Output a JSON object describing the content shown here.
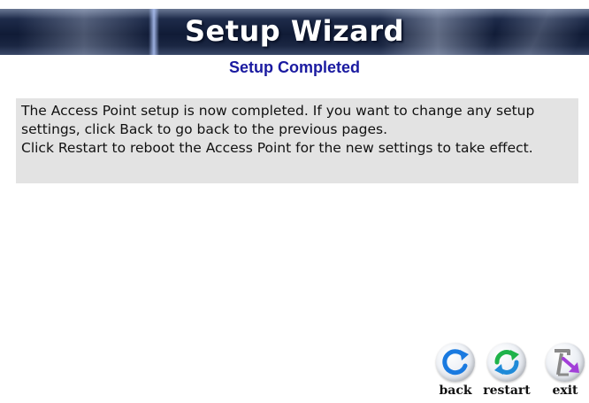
{
  "header": {
    "title": "Setup Wizard",
    "subtitle": "Setup Completed"
  },
  "message": {
    "line1": "The Access Point setup is now completed. If you want to change any setup settings, click Back to go back to the previous pages.",
    "line2": "Click Restart to reboot the Access Point for the new settings to take effect."
  },
  "buttons": {
    "back": {
      "label": "back",
      "icon": "back-arrow-icon",
      "color": "#1a7ae0"
    },
    "restart": {
      "label": "restart",
      "icon": "restart-cycle-icon",
      "color": "#1fb34a"
    },
    "exit": {
      "label": "exit",
      "icon": "exit-door-icon",
      "color": "#a23fd8"
    }
  },
  "colors": {
    "banner_dark": "#101b36",
    "subtitle": "#1a1aa0",
    "info_box_bg": "#e3e3e3"
  }
}
